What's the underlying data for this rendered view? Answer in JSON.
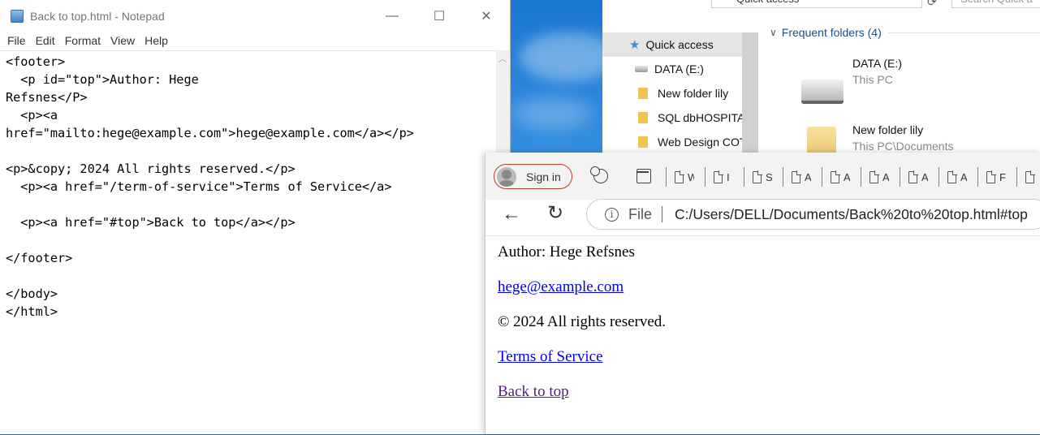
{
  "notepad": {
    "title": "Back to top.html - Notepad",
    "controls": {
      "minimize": "—",
      "maximize": "☐",
      "close": "✕"
    },
    "menu": [
      "File",
      "Edit",
      "Format",
      "View",
      "Help"
    ],
    "content": "<footer>\n  <p id=\"top\">Author: Hege\nRefsnes</P>\n  <p><a\nhref=\"mailto:hege@example.com\">hege@example.com</a></p>\n\n<p>&copy; 2024 All rights reserved.</p>\n  <p><a href=\"/term-of-service\">Terms of Service</a>\n\n  <p><a href=\"#top\">Back to top</a></p>\n\n</footer>\n\n</body>\n</html>"
  },
  "explorer": {
    "address": "Quick access",
    "search_placeholder": "Search Quick a",
    "nav": [
      {
        "label": "Quick access",
        "icon": "star-icon"
      },
      {
        "label": "DATA (E:)",
        "icon": "drive-icon"
      },
      {
        "label": "New folder lily",
        "icon": "folder-icon"
      },
      {
        "label": "SQL dbHOSPITA",
        "icon": "folder-icon"
      },
      {
        "label": "Web Design COT",
        "icon": "folder-icon"
      }
    ],
    "group_title": "Frequent folders (4)",
    "tiles": [
      {
        "name": "DATA (E:)",
        "location": "This PC"
      },
      {
        "name": "New folder lily",
        "location": "This PC\\Documents"
      }
    ]
  },
  "browser": {
    "signin_label": "Sign in",
    "tabs": [
      "W",
      "I",
      "S",
      "A",
      "A",
      "A",
      "A",
      "A",
      "F",
      ""
    ],
    "url_scheme": "File",
    "url": "C:/Users/DELL/Documents/Back%20to%20top.html#top",
    "page": {
      "author": "Author: Hege Refsnes",
      "email": "hege@example.com",
      "copyright": "© 2024 All rights reserved.",
      "terms": "Terms of Service",
      "back_to_top": "Back to top"
    }
  },
  "colors": {
    "link": "#0000ee",
    "visited_link": "#551a8b",
    "signin_border": "#c0392b",
    "desktop": "#2f86d8"
  }
}
